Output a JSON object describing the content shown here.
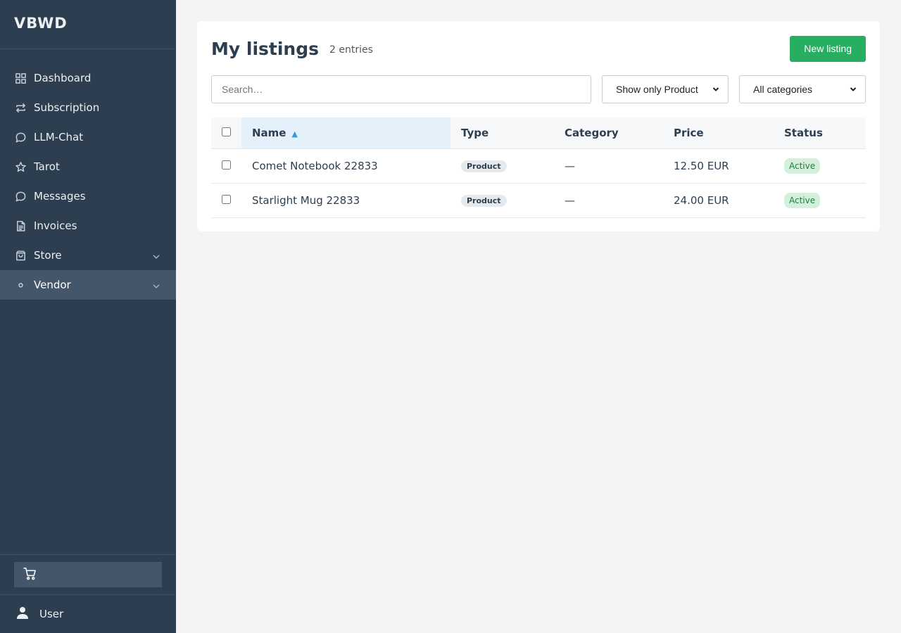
{
  "brand": "VBWD",
  "sidebar": {
    "items": [
      {
        "label": "Dashboard",
        "icon": "grid-icon"
      },
      {
        "label": "Subscription",
        "icon": "repeat-icon"
      },
      {
        "label": "LLM-Chat",
        "icon": "chat-bubble-icon"
      },
      {
        "label": "Tarot",
        "icon": "star-icon"
      },
      {
        "label": "Messages",
        "icon": "chat-bubble-icon"
      },
      {
        "label": "Invoices",
        "icon": "document-icon"
      },
      {
        "label": "Store",
        "icon": "bag-icon",
        "expandable": true
      },
      {
        "label": "Vendor",
        "icon": "dot-icon",
        "expandable": true,
        "active": true
      }
    ],
    "cart_icon": "cart-icon",
    "user_label": "User",
    "user_icon": "user-icon"
  },
  "main": {
    "title": "My listings",
    "entry_count": "2 entries",
    "new_button": "New listing",
    "search_placeholder": "Search…",
    "type_filter": "Show only Product",
    "category_filter": "All categories",
    "table": {
      "headers": {
        "name": "Name",
        "type": "Type",
        "category": "Category",
        "price": "Price",
        "status": "Status"
      },
      "sort_indicator": "▲",
      "rows": [
        {
          "name": "Comet Notebook 22833",
          "type": "Product",
          "category": "—",
          "price": "12.50 EUR",
          "status": "Active"
        },
        {
          "name": "Starlight Mug 22833",
          "type": "Product",
          "category": "—",
          "price": "24.00 EUR",
          "status": "Active"
        }
      ]
    }
  },
  "colors": {
    "sidebar_bg": "#2c3e50",
    "sidebar_active": "#43566a",
    "accent_green": "#27ae60",
    "status_bg": "#d4efdc",
    "sort_accent": "#3498db"
  }
}
